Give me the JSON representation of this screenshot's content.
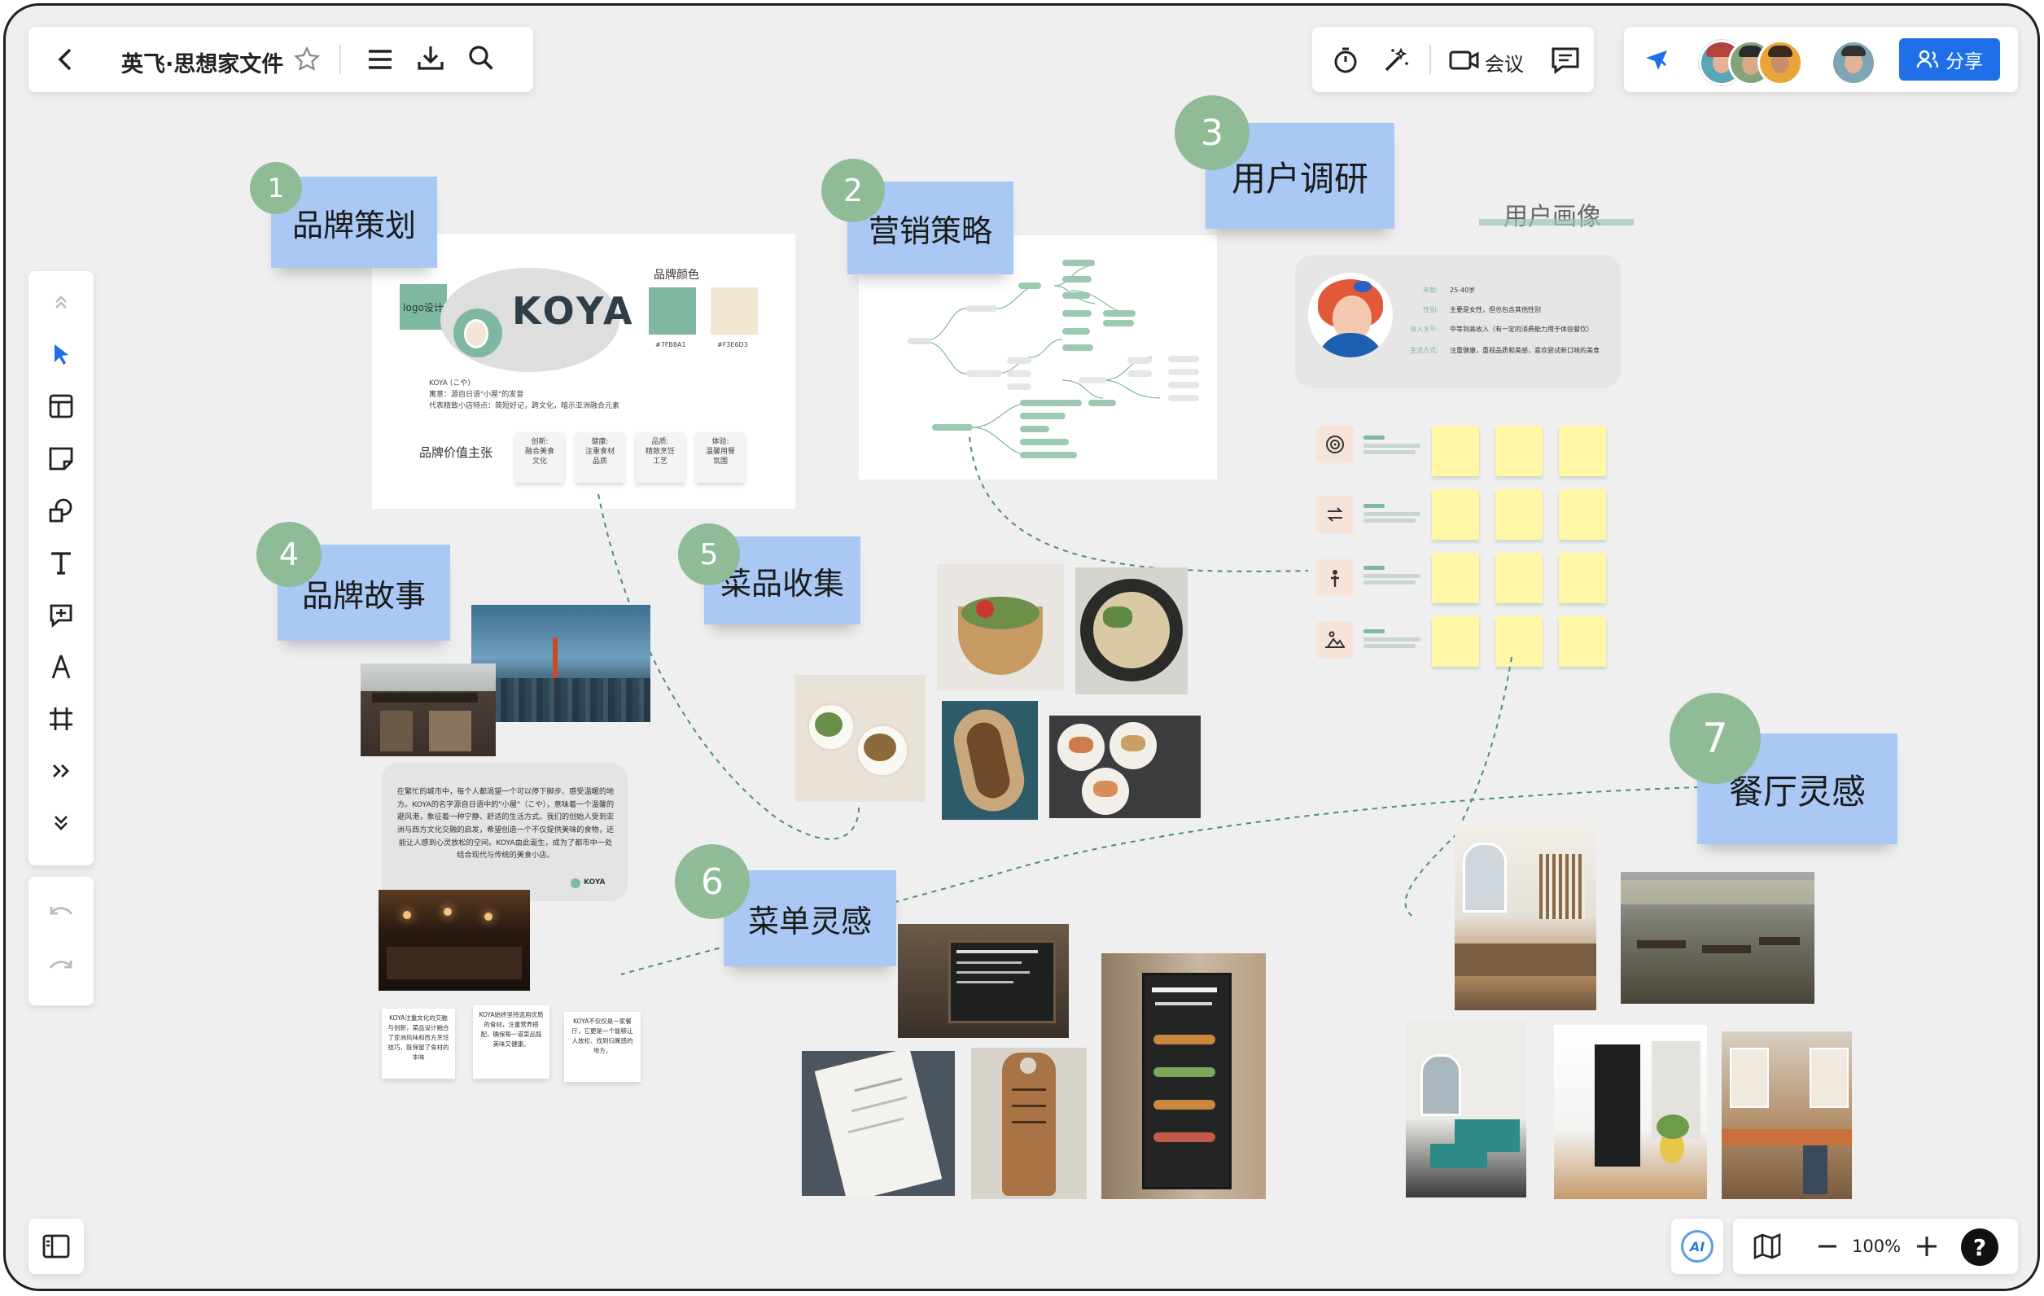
{
  "doc": {
    "title": "英飞·思想家文件"
  },
  "toolbar": {
    "meeting_label": "会议",
    "share_label": "分享",
    "zoom": "100%",
    "ai_label": "AI"
  },
  "frames": [
    {
      "num": "1",
      "label": "品牌策划"
    },
    {
      "num": "2",
      "label": "营销策略"
    },
    {
      "num": "3",
      "label": "用户调研"
    },
    {
      "num": "4",
      "label": "品牌故事"
    },
    {
      "num": "5",
      "label": "菜品收集"
    },
    {
      "num": "6",
      "label": "菜单灵感"
    },
    {
      "num": "7",
      "label": "餐厅灵感"
    }
  ],
  "brand": {
    "logo_tag": "logo设计",
    "wordmark": "KOYA",
    "colors_title": "品牌颜色",
    "color1": {
      "hex": "#7FB8A1",
      "label": "#7FB8A1"
    },
    "color2": {
      "hex": "#F3E6D3",
      "label": "#F3E6D3"
    },
    "desc": [
      "KOYA (こや)",
      "寓意：源自日语\"小屋\"的发音",
      "代表精致小店特点：简短好记，跨文化，暗示亚洲融合元素"
    ],
    "values_title": "品牌价值主张",
    "values": [
      "创新:\n融合美食\n文化",
      "健康:\n注重食材\n品质",
      "品质:\n精致烹饪\n工艺",
      "体验:\n温馨用餐\n氛围"
    ]
  },
  "persona": {
    "title": "用户画像",
    "rows": [
      {
        "k": "年龄:",
        "v": "25-40岁"
      },
      {
        "k": "性别:",
        "v": "主要是女性，但也包含其他性别"
      },
      {
        "k": "收入水平:",
        "v": "中等到高收入（有一定的消费能力用于体验餐饮）"
      },
      {
        "k": "生活方式:",
        "v": "注重健康，重视品质和美感，喜欢尝试新口味的美食"
      }
    ]
  },
  "story": {
    "text": "在繁忙的城市中，每个人都渴望一个可以停下脚步、感受温暖的地方。KOYA的名字源自日语中的\"小屋\"（こや），意味着一个温馨的避风港，象征着一种宁静、舒适的生活方式。我们的创始人受到亚洲与西方文化交融的启发，希望创造一个不仅提供美味的食物，还能让人感到心灵放松的空间。KOYA由此诞生，成为了都市中一处结合现代与传统的美食小店。",
    "logo": "KOYA",
    "notes": [
      "KOYA注重文化的交融与创新，菜品设计融合了亚洲风味和西方烹饪技巧，既保留了食材的本味",
      "KOYA始终坚持选用优质的食材，注重营养搭配，确保每一道菜品既美味又健康。",
      "KOYA不仅仅是一家餐厅，它更是一个能够让人放松、找到归属感的地方。"
    ]
  },
  "colors": {
    "accent": "#1e6fe8",
    "sticky_blue": "#a9c8f3",
    "badge_green": "#8fbc97",
    "brand_green": "#7FB8A1",
    "brand_cream": "#F3E6D3"
  },
  "icons": [
    "back-arrow-icon",
    "star-icon",
    "menu-icon",
    "download-icon",
    "search-icon",
    "timer-icon",
    "magic-wand-icon",
    "video-icon",
    "comment-icon",
    "cursor-icon",
    "share-user-icon",
    "collapse-up-icon",
    "select-arrow-icon",
    "template-icon",
    "sticky-note-icon",
    "shapes-icon",
    "text-icon",
    "comment-add-icon",
    "pen-icon",
    "frame-icon",
    "more-icon",
    "expand-down-icon",
    "undo-icon",
    "redo-icon",
    "sidebar-toggle-icon",
    "map-icon",
    "zoom-out-icon",
    "zoom-in-icon",
    "help-icon"
  ]
}
